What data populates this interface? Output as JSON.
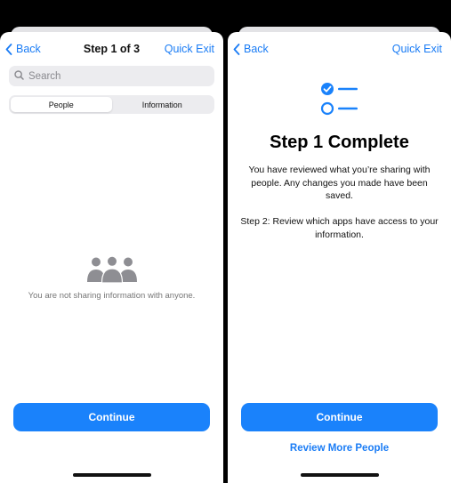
{
  "accent_color": "#1a82fb",
  "left_screen": {
    "nav": {
      "back_label": "Back",
      "title": "Step 1 of 3",
      "exit_label": "Quick Exit"
    },
    "search": {
      "placeholder": "Search",
      "value": ""
    },
    "segmented": {
      "tabs": [
        "People",
        "Information"
      ],
      "selected": "People"
    },
    "empty_state": {
      "icon": "people-group-icon",
      "message": "You are not sharing information with anyone."
    },
    "continue_label": "Continue"
  },
  "right_screen": {
    "nav": {
      "back_label": "Back",
      "exit_label": "Quick Exit"
    },
    "icon": "checklist-icon",
    "title": "Step 1 Complete",
    "body": "You have reviewed what you’re sharing with people. Any changes you made have been saved.",
    "step2": "Step 2: Review which apps have access to your information.",
    "continue_label": "Continue",
    "review_more_label": "Review More People"
  }
}
